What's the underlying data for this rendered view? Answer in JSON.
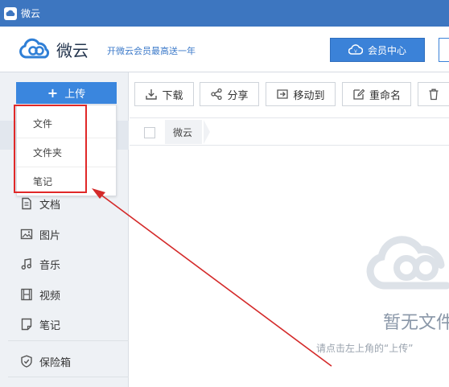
{
  "window": {
    "title": "微云",
    "title_icon": "cloud-app-icon"
  },
  "header": {
    "brand": "微云",
    "promo": "开微云会员最高送一年",
    "vip_button": "会员中心"
  },
  "sidebar": {
    "upload_label": "上传",
    "upload_menu": [
      "文件",
      "文件夹",
      "笔记"
    ],
    "items": [
      {
        "label": "文档",
        "icon": "document-icon"
      },
      {
        "label": "图片",
        "icon": "image-icon"
      },
      {
        "label": "音乐",
        "icon": "music-icon"
      },
      {
        "label": "视频",
        "icon": "video-icon"
      },
      {
        "label": "笔记",
        "icon": "note-icon"
      },
      {
        "label": "保险箱",
        "icon": "shield-icon"
      }
    ]
  },
  "toolbar": {
    "download": "下载",
    "share": "分享",
    "move_to": "移动到",
    "rename": "重命名"
  },
  "breadcrumb": {
    "root": "微云"
  },
  "empty_state": {
    "title": "暂无文件",
    "hint": "请点击左上角的“上传”"
  },
  "colors": {
    "titlebar": "#3d76c0",
    "accent": "#3a86de",
    "annotation": "#e02828"
  }
}
